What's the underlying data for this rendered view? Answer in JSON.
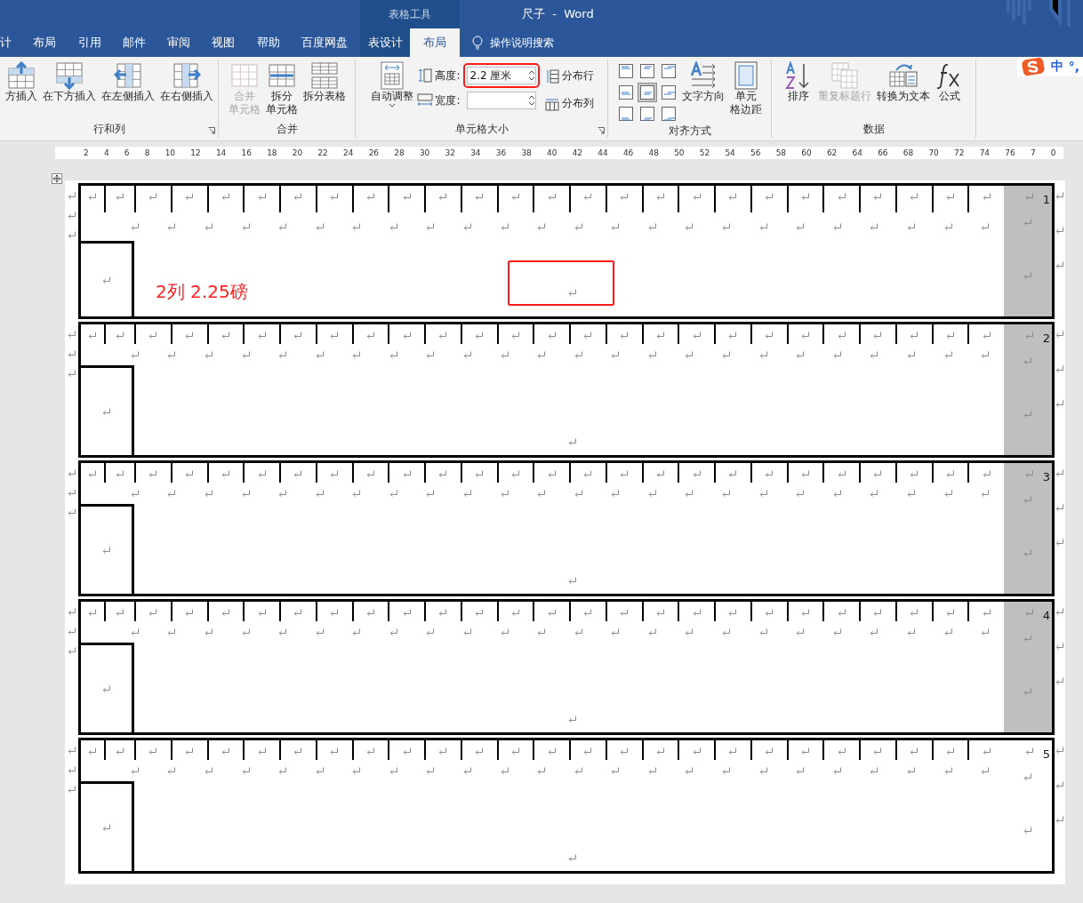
{
  "title_bar": {
    "context_label": "表格工具",
    "title": "尺子  -  Word"
  },
  "tabs": [
    {
      "label": "计",
      "selected": false,
      "contextual": false
    },
    {
      "label": "布局",
      "selected": false,
      "contextual": false
    },
    {
      "label": "引用",
      "selected": false,
      "contextual": false
    },
    {
      "label": "邮件",
      "selected": false,
      "contextual": false
    },
    {
      "label": "审阅",
      "selected": false,
      "contextual": false
    },
    {
      "label": "视图",
      "selected": false,
      "contextual": false
    },
    {
      "label": "帮助",
      "selected": false,
      "contextual": false
    },
    {
      "label": "百度网盘",
      "selected": false,
      "contextual": false
    },
    {
      "label": "表设计",
      "selected": false,
      "contextual": true
    },
    {
      "label": "布局",
      "selected": true,
      "contextual": true
    }
  ],
  "tell_me": "操作说明搜索",
  "ime": {
    "language": "中",
    "punctuation": "°,"
  },
  "ribbon_groups": [
    {
      "label": "行和列",
      "launcher": true,
      "items": [
        {
          "kind": "large",
          "lines": [
            "方插入"
          ],
          "disabled": false
        },
        {
          "kind": "large",
          "lines": [
            "在下方插入"
          ],
          "disabled": false
        },
        {
          "kind": "large",
          "lines": [
            "在左侧插入"
          ],
          "disabled": false
        },
        {
          "kind": "large",
          "lines": [
            "在右侧插入"
          ],
          "disabled": false
        }
      ]
    },
    {
      "label": "合并",
      "launcher": false,
      "items": [
        {
          "kind": "large",
          "lines": [
            "合并",
            "单元格"
          ],
          "disabled": true
        },
        {
          "kind": "large",
          "lines": [
            "拆分",
            "单元格"
          ],
          "disabled": false
        },
        {
          "kind": "large",
          "lines": [
            "拆分表格"
          ],
          "disabled": false
        }
      ]
    },
    {
      "label": "单元格大小",
      "launcher": true,
      "items": [
        {
          "kind": "large",
          "lines": [
            "自动调整"
          ],
          "disabled": false,
          "caret": true
        },
        {
          "kind": "fields",
          "fields": [
            {
              "label": "高度:",
              "value": "2.2 厘米",
              "highlighted": true
            },
            {
              "label": "宽度:",
              "highlighted": false
            }
          ]
        },
        {
          "kind": "smalls",
          "buttons": [
            {
              "label": "分布行"
            },
            {
              "label": "分布列"
            }
          ]
        }
      ]
    },
    {
      "label": "对齐方式",
      "launcher": false,
      "items": [
        {
          "kind": "align",
          "cells": [
            {
              "selected": false
            },
            {
              "selected": false
            },
            {
              "selected": false
            },
            {
              "selected": false
            },
            {
              "selected": true
            },
            {
              "selected": false
            },
            {
              "selected": false
            },
            {
              "selected": false
            },
            {
              "selected": false
            }
          ]
        },
        {
          "kind": "large",
          "lines": [
            "文字方向"
          ],
          "disabled": false
        },
        {
          "kind": "large",
          "lines": [
            "单元",
            "格边距"
          ],
          "disabled": false
        }
      ]
    },
    {
      "label": "数据",
      "launcher": false,
      "items": [
        {
          "kind": "large",
          "lines": [
            "排序"
          ],
          "disabled": false
        },
        {
          "kind": "large",
          "lines": [
            "重复标题行"
          ],
          "disabled": true
        },
        {
          "kind": "large",
          "lines": [
            "转换为文本"
          ],
          "disabled": false
        },
        {
          "kind": "large",
          "lines": [
            "公式"
          ],
          "disabled": false
        }
      ]
    }
  ],
  "ruler": {
    "labels": [
      "2",
      "4",
      "6",
      "8",
      "10",
      "12",
      "14",
      "16",
      "18",
      "20",
      "22",
      "24",
      "26",
      "28",
      "30",
      "32",
      "34",
      "36",
      "38",
      "40",
      "42",
      "44",
      "46",
      "48",
      "50",
      "52",
      "54",
      "56",
      "58",
      "60",
      "62",
      "64",
      "66",
      "68",
      "70",
      "72",
      "74",
      "76",
      "7",
      "0"
    ]
  },
  "tables": [
    {
      "number": "1",
      "shaded": true,
      "highlight": true,
      "note": "2列 2.25磅"
    },
    {
      "number": "2",
      "shaded": true,
      "highlight": false
    },
    {
      "number": "3",
      "shaded": true,
      "highlight": false
    },
    {
      "number": "4",
      "shaded": true,
      "highlight": false
    },
    {
      "number": "5",
      "shaded": false,
      "highlight": false
    }
  ]
}
